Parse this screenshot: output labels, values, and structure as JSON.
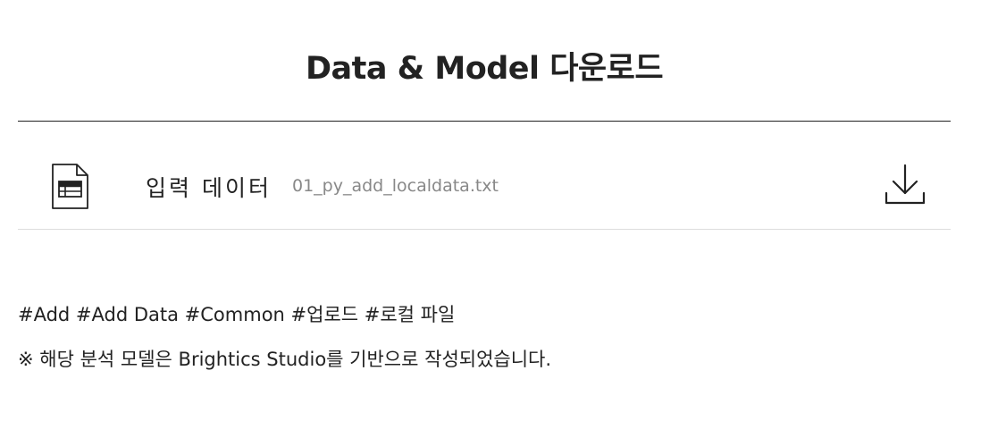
{
  "page": {
    "title": "Data & Model 다운로드"
  },
  "file_row": {
    "icon": "spreadsheet-file-icon",
    "label": "입력 데이터",
    "file_name": "01_py_add_localdata.txt",
    "download_icon": "download-icon"
  },
  "tags": {
    "text": "#Add #Add Data #Common #업로드 #로컬 파일"
  },
  "notice": {
    "text": "※ 해당 분석 모델은 Brightics Studio를 기반으로 작성되었습니다."
  }
}
